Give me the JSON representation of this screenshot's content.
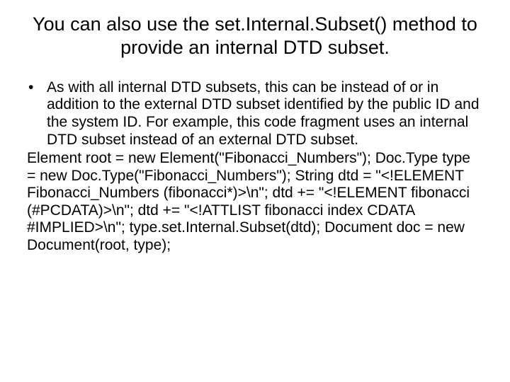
{
  "title": "You can also use the set.Internal.Subset() method to provide an internal DTD subset.",
  "bullet": "As with all internal DTD subsets, this can be instead of or in addition to the external DTD subset identified by the public ID and the system ID. For example, this code fragment uses an internal DTD subset instead of an external DTD subset.",
  "code": "Element root = new Element(\"Fibonacci_Numbers\"); Doc.Type type = new Doc.Type(\"Fibonacci_Numbers\"); String dtd = \"<!ELEMENT Fibonacci_Numbers (fibonacci*)>\\n\"; dtd += \"<!ELEMENT fibonacci (#PCDATA)>\\n\"; dtd += \"<!ATTLIST fibonacci index CDATA #IMPLIED>\\n\"; type.set.Internal.Subset(dtd); Document doc = new Document(root, type);"
}
